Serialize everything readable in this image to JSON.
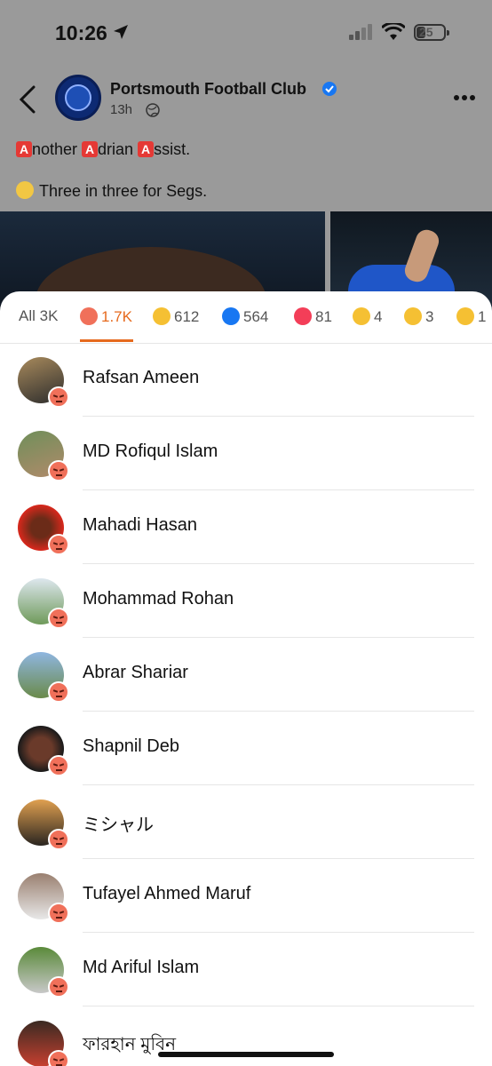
{
  "status_bar": {
    "time": "10:26",
    "battery": "25"
  },
  "post": {
    "page_name": "Portsmouth Football Club",
    "time_ago": "13h",
    "line1": [
      {
        "letter": "A",
        "rest": "nother "
      },
      {
        "letter": "A",
        "rest": "drian "
      },
      {
        "letter": "A",
        "rest": "ssist."
      }
    ],
    "line2": "Three in three for Segs."
  },
  "tabs": [
    {
      "label": "All 3K",
      "icon": "none"
    },
    {
      "label": "1.7K",
      "icon": "angry-icon",
      "active": true
    },
    {
      "label": "612",
      "icon": "haha-icon"
    },
    {
      "label": "564",
      "icon": "like-icon"
    },
    {
      "label": "81",
      "icon": "love-icon"
    },
    {
      "label": "4",
      "icon": "care-icon"
    },
    {
      "label": "3",
      "icon": "sad-icon"
    },
    {
      "label": "1",
      "icon": "wow-icon"
    }
  ],
  "people": [
    {
      "name": "Rafsan Ameen"
    },
    {
      "name": "MD Rofiqul Islam"
    },
    {
      "name": "Mahadi Hasan"
    },
    {
      "name": "Mohammad Rohan"
    },
    {
      "name": "Abrar Shariar"
    },
    {
      "name": "Shapnil Deb"
    },
    {
      "name": "ミシャル"
    },
    {
      "name": "Tufayel Ahmed Maruf"
    },
    {
      "name": "Md Ariful Islam"
    },
    {
      "name": "ফারহান মুবিন"
    }
  ],
  "colors": {
    "accent": "#e66a1e",
    "angry": "#f0705a",
    "verified": "#1877f2"
  }
}
